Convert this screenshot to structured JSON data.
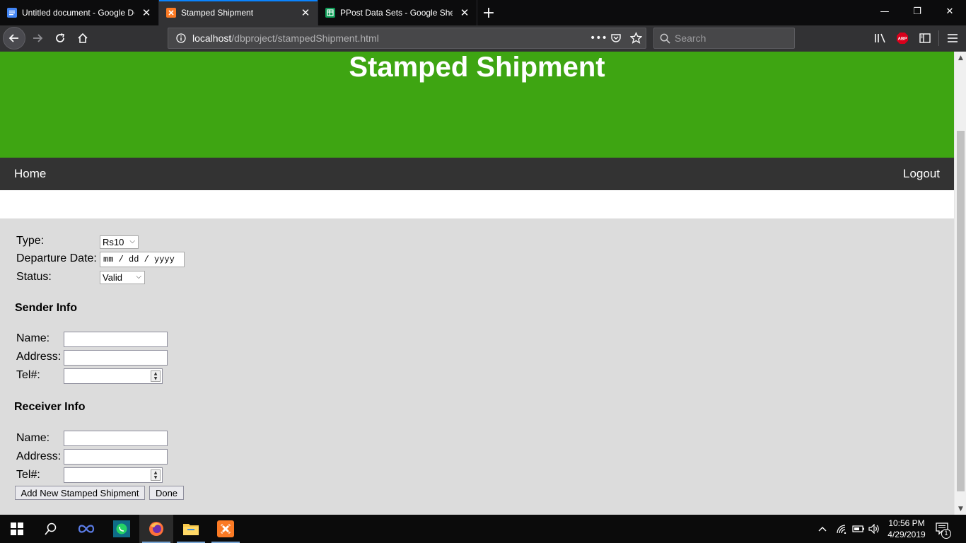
{
  "browser": {
    "tabs": [
      {
        "title": "Untitled document - Google Do",
        "favicon": "google-docs-icon",
        "active": false
      },
      {
        "title": "Stamped Shipment",
        "favicon": "xampp-icon",
        "active": true
      },
      {
        "title": "PPost Data Sets - Google Sheets",
        "favicon": "google-sheets-icon",
        "active": false
      }
    ],
    "url_host": "localhost",
    "url_path": "/dbproject/stampedShipment.html",
    "search_placeholder": "Search"
  },
  "page": {
    "header_title": "Stamped Shipment",
    "nav": {
      "home": "Home",
      "logout": "Logout"
    },
    "form": {
      "type_label": "Type:",
      "type_value": "Rs10",
      "departure_label": "Departure Date:",
      "departure_value": "mm / dd / yyyy",
      "status_label": "Status:",
      "status_value": "Valid",
      "sender_heading": "Sender Info",
      "receiver_heading": "Receiver Info",
      "name_label": "Name:",
      "address_label": "Address:",
      "tel_label": "Tel#:",
      "add_button": "Add New Stamped Shipment",
      "done_button": "Done"
    }
  },
  "taskbar": {
    "time": "10:56 PM",
    "date": "4/29/2019",
    "notification_count": "1"
  },
  "colors": {
    "header_green": "#3ea512",
    "nav_dark": "#333333",
    "form_bg": "#dcdcdc",
    "tab_accent": "#0a84ff"
  }
}
